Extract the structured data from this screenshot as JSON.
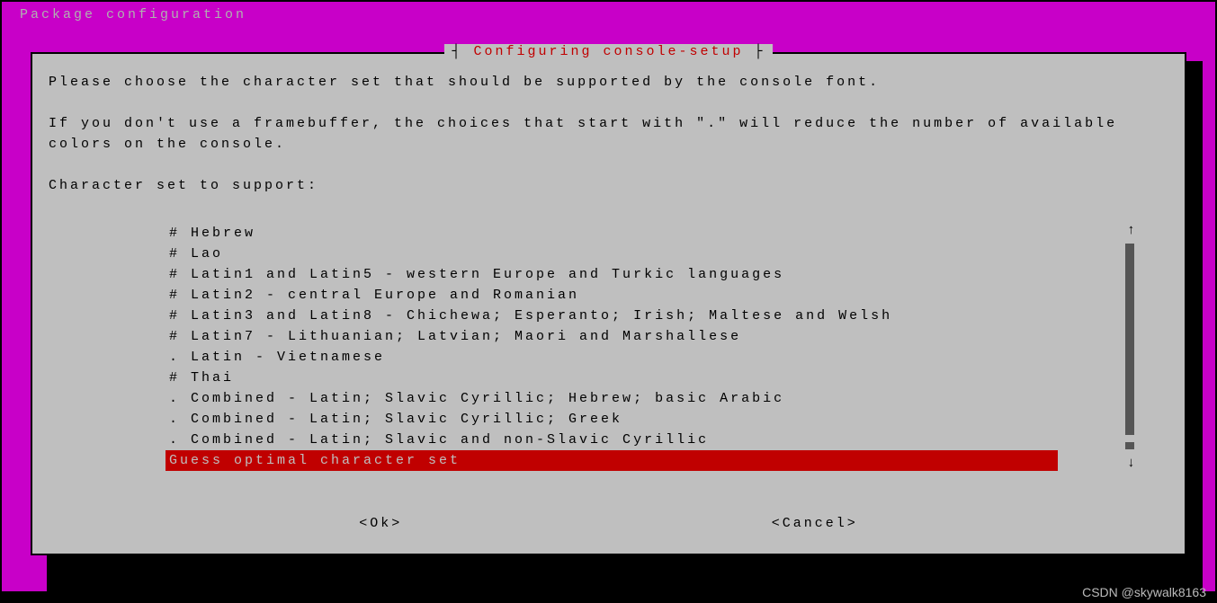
{
  "header": "Package configuration",
  "dialog": {
    "title_brackets_left": "┤ ",
    "title_text": "Configuring console-setup",
    "title_brackets_right": " ├",
    "line1": "Please choose the character set that should be supported by the console font.",
    "line2": "If you don't use a framebuffer, the choices that start with \".\" will reduce the number of available colors on the console.",
    "prompt": "Character set to support:",
    "items": [
      "# Hebrew",
      "# Lao",
      "# Latin1 and Latin5 - western Europe and Turkic languages",
      "# Latin2 - central Europe and Romanian",
      "# Latin3 and Latin8 - Chichewa; Esperanto; Irish; Maltese and Welsh",
      "# Latin7 - Lithuanian; Latvian; Maori and Marshallese",
      ". Latin - Vietnamese",
      "# Thai",
      ". Combined - Latin; Slavic Cyrillic; Hebrew; basic Arabic",
      ". Combined - Latin; Slavic Cyrillic; Greek",
      ". Combined - Latin; Slavic and non-Slavic Cyrillic",
      "Guess optimal character set"
    ],
    "selected_index": 11,
    "scroll_up": "↑",
    "scroll_down": "↓",
    "ok": "<Ok>",
    "cancel": "<Cancel>"
  },
  "watermark": "CSDN @skywalk8163"
}
